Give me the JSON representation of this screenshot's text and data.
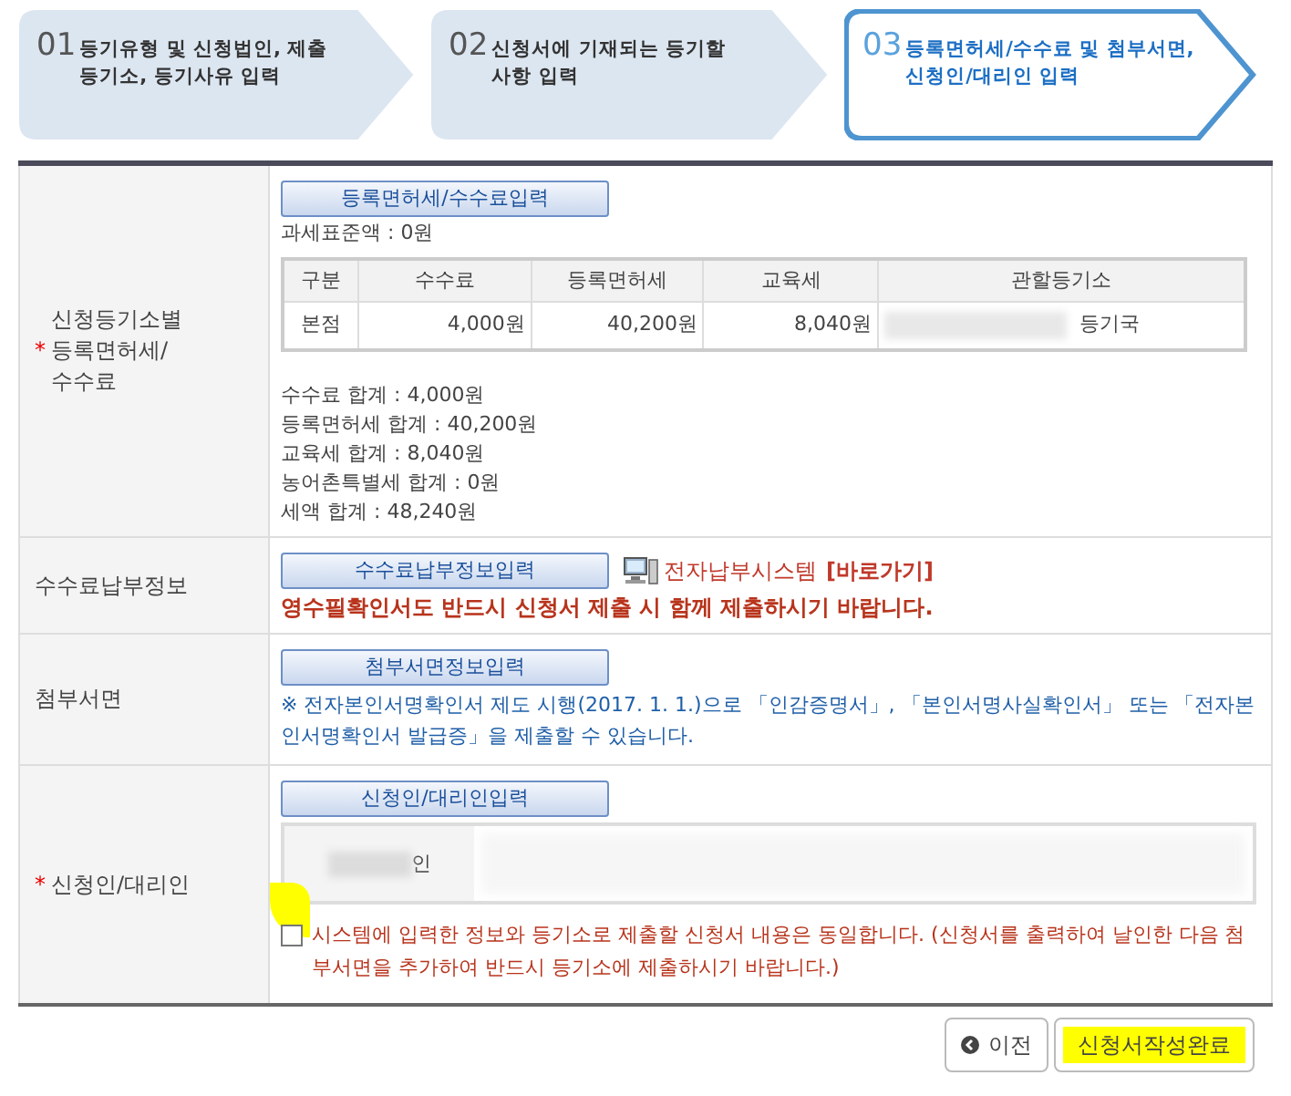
{
  "steps": [
    {
      "number": "01",
      "title": "등기유형 및 신청법인, 제출 등기소, 등기사유 입력",
      "selected": false
    },
    {
      "number": "02",
      "title": "신청서에 기재되는 등기할 사항 입력",
      "selected": false
    },
    {
      "number": "03",
      "title": "등록면허세/수수료 및 첨부서면, 신청인/대리인 입력",
      "selected": true
    }
  ],
  "sections": [
    {
      "kind": "fees",
      "required_mark": "*",
      "label": "신청등기소별 등록면허세/ 수수료",
      "button": "등록면허세/수수료입력",
      "tax_base": "과세표준액 : 0원",
      "table": {
        "columns": [
          "구분",
          "수수료",
          "등록면허세",
          "교육세",
          "관할등기소"
        ],
        "rows": [
          [
            "본점",
            "4,000원",
            "40,200원",
            "8,040원",
            "등기국"
          ]
        ]
      },
      "totals": [
        "수수료 합계 : 4,000원",
        "등록면허세 합계 : 40,200원",
        "교육세 합계 : 8,040원",
        "농어촌특별세 합계 : 0원",
        "세액 합계 : 48,240원"
      ]
    },
    {
      "kind": "payment",
      "label": "수수료납부정보",
      "button": "수수료납부정보입력",
      "system_link": "전자납부시스템",
      "shortcut": "[바로가기]",
      "notice": "영수필확인서도 반드시 신청서 제출 시 함께 제출하시기 바랍니다."
    },
    {
      "kind": "attachments",
      "label": "첨부서면",
      "button": "첨부서면정보입력",
      "notice": "※ 전자본인서명확인서 제도 시행(2017. 1. 1.)으로 「인감증명서」, 「본인서명사실확인서」 또는 「전자본인서명확인서 발급증」을 제출할 수 있습니다."
    },
    {
      "kind": "applicant",
      "required_mark": "*",
      "label": "신청인/대리인",
      "button": "신청인/대리인입력",
      "applicant_name": "인",
      "agree_checked": false,
      "agree_text": "시스템에 입력한 정보와 등기소로 제출할 신청서 내용은 동일합니다. (신청서를 출력하여 날인한 다음 첨부서면을 추가하여 반드시 등기소에 제출하시기 바랍니다.)"
    }
  ],
  "buttons": {
    "previous": "이전",
    "complete": "신청서작성완료"
  }
}
